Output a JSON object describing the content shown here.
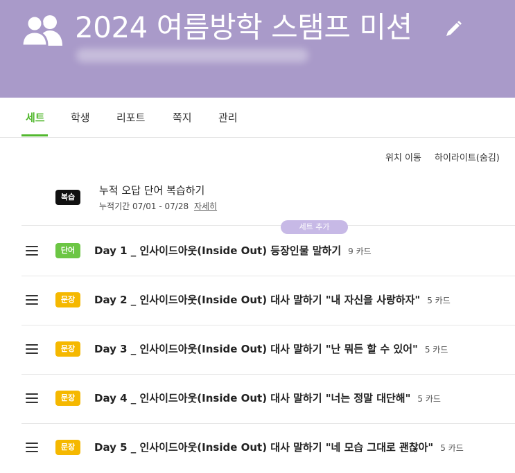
{
  "header": {
    "title": "2024 여름방학 스탬프 미션",
    "icon": "users-icon",
    "edit_icon": "pencil-icon",
    "background": "#a99ac9"
  },
  "tabs": [
    {
      "label": "세트",
      "active": true
    },
    {
      "label": "학생",
      "active": false
    },
    {
      "label": "리포트",
      "active": false
    },
    {
      "label": "쪽지",
      "active": false
    },
    {
      "label": "관리",
      "active": false
    }
  ],
  "toolbar": {
    "move_label": "위치 이동",
    "highlight_label": "하이라이트(숨김)"
  },
  "review": {
    "badge": "복습",
    "title": "누적 오답 단어 복습하기",
    "period": "누적기간 07/01 - 07/28",
    "detail_link": "자세히"
  },
  "add_set_label": "세트 추가",
  "colors": {
    "accent_green": "#52b82e",
    "word_tag": "#6cc644",
    "sentence_tag": "#f5b800",
    "add_button": "#c7b9e6"
  },
  "sets": [
    {
      "tag": "단어",
      "tag_type": "word",
      "title": "Day 1 _ 인사이드아웃(Inside Out) 등장인물 말하기",
      "count": "9 카드"
    },
    {
      "tag": "문장",
      "tag_type": "sentence",
      "title": "Day 2 _ 인사이드아웃(Inside Out) 대사 말하기 \"내 자신을 사랑하자\"",
      "count": "5 카드"
    },
    {
      "tag": "문장",
      "tag_type": "sentence",
      "title": "Day 3 _ 인사이드아웃(Inside Out) 대사 말하기 \"난 뭐든 할 수 있어\"",
      "count": "5 카드"
    },
    {
      "tag": "문장",
      "tag_type": "sentence",
      "title": "Day 4 _ 인사이드아웃(Inside Out) 대사 말하기 \"너는 정말 대단해\"",
      "count": "5 카드"
    },
    {
      "tag": "문장",
      "tag_type": "sentence",
      "title": "Day 5 _ 인사이드아웃(Inside Out) 대사 말하기 \"네 모습 그대로 괜찮아\"",
      "count": "5 카드"
    }
  ]
}
